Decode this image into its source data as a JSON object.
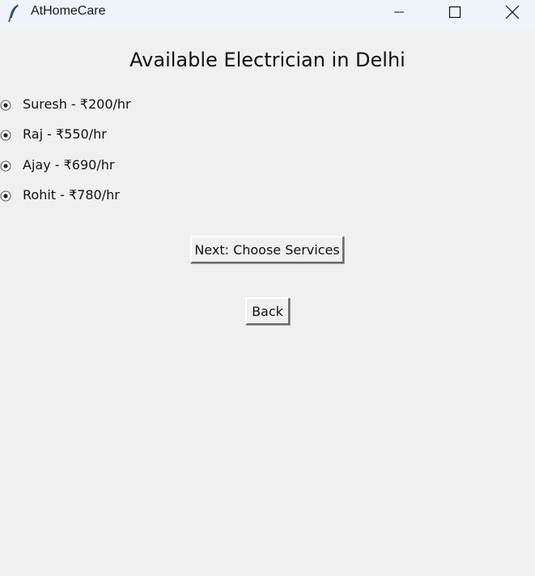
{
  "window": {
    "title": "AtHomeCare",
    "icon": "feather-icon",
    "controls": [
      "minimize-icon",
      "maximize-icon",
      "close-icon"
    ]
  },
  "main": {
    "heading": "Available Electrician in Delhi",
    "electricians": [
      {
        "label": "Suresh - ₹200/hr",
        "selected": false
      },
      {
        "label": "Raj - ₹550/hr",
        "selected": false
      },
      {
        "label": "Ajay - ₹690/hr",
        "selected": false
      },
      {
        "label": "Rohit - ₹780/hr",
        "selected": false
      }
    ],
    "next_label": "Next: Choose Services",
    "back_label": "Back"
  }
}
